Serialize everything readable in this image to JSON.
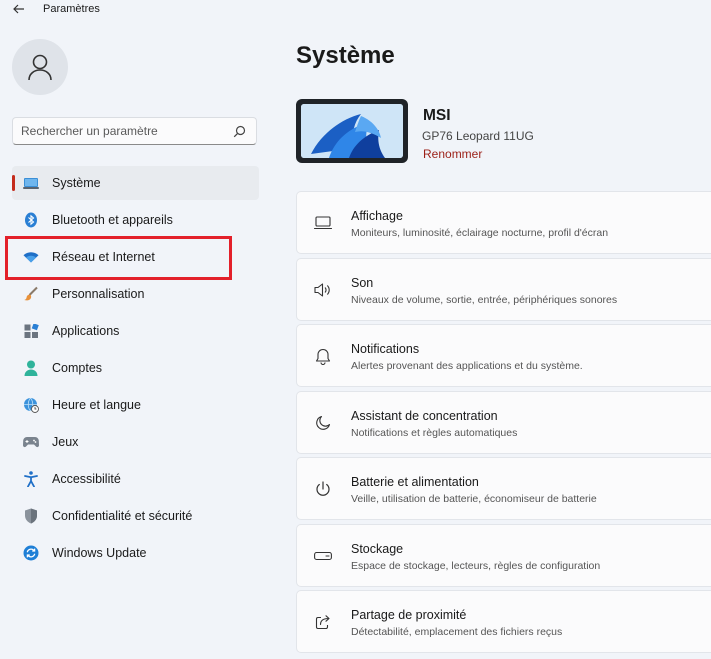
{
  "window": {
    "title": "Paramètres"
  },
  "search": {
    "placeholder": "Rechercher un paramètre"
  },
  "sidebar": {
    "items": [
      {
        "label": "Système",
        "icon": "laptop-icon",
        "selected": true
      },
      {
        "label": "Bluetooth et appareils",
        "icon": "bluetooth-icon"
      },
      {
        "label": "Réseau et Internet",
        "icon": "wifi-icon"
      },
      {
        "label": "Personnalisation",
        "icon": "brush-icon"
      },
      {
        "label": "Applications",
        "icon": "apps-icon"
      },
      {
        "label": "Comptes",
        "icon": "person-icon"
      },
      {
        "label": "Heure et langue",
        "icon": "globe-clock-icon"
      },
      {
        "label": "Jeux",
        "icon": "gamepad-icon"
      },
      {
        "label": "Accessibilité",
        "icon": "accessibility-icon"
      },
      {
        "label": "Confidentialité et sécurité",
        "icon": "shield-icon"
      },
      {
        "label": "Windows Update",
        "icon": "refresh-icon"
      }
    ]
  },
  "main": {
    "title": "Système",
    "device": {
      "name": "MSI",
      "model": "GP76 Leopard 11UG",
      "rename_label": "Renommer"
    },
    "cards": [
      {
        "title": "Affichage",
        "subtitle": "Moniteurs, luminosité, éclairage nocturne, profil d'écran",
        "icon": "monitor-icon"
      },
      {
        "title": "Son",
        "subtitle": "Niveaux de volume, sortie, entrée, périphériques sonores",
        "icon": "speaker-icon"
      },
      {
        "title": "Notifications",
        "subtitle": "Alertes provenant des applications et du système.",
        "icon": "bell-icon"
      },
      {
        "title": "Assistant de concentration",
        "subtitle": "Notifications et règles automatiques",
        "icon": "moon-icon"
      },
      {
        "title": "Batterie et alimentation",
        "subtitle": "Veille, utilisation de batterie, économiseur de batterie",
        "icon": "power-icon"
      },
      {
        "title": "Stockage",
        "subtitle": "Espace de stockage, lecteurs, règles de configuration",
        "icon": "storage-icon"
      },
      {
        "title": "Partage de proximité",
        "subtitle": "Détectabilité, emplacement des fichiers reçus",
        "icon": "share-icon"
      }
    ]
  },
  "colors": {
    "accent": "#c42b1c",
    "highlight_box": "#e3202a",
    "background": "#f1f4f9"
  }
}
